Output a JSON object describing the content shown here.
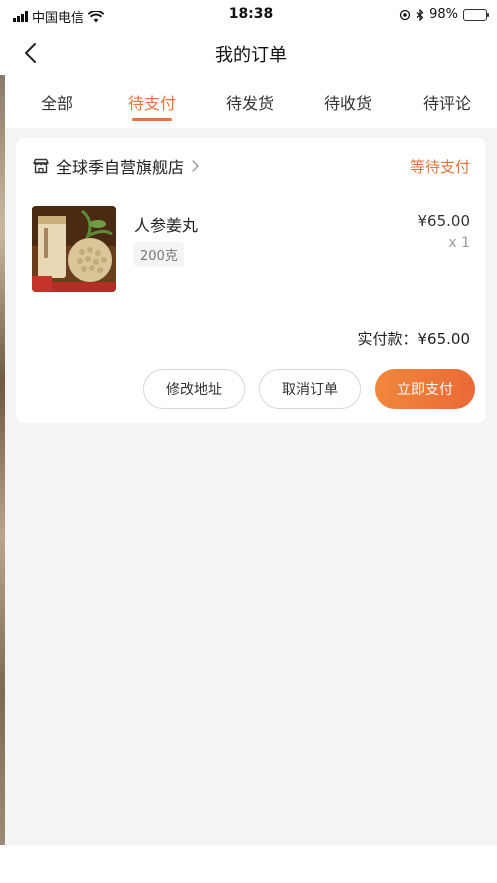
{
  "status_bar": {
    "carrier": "中国电信",
    "time": "18:38",
    "battery_percent": "98%",
    "icons": [
      "signal-icon",
      "wifi-icon",
      "location-icon",
      "bluetooth-icon",
      "battery-icon"
    ]
  },
  "nav": {
    "title": "我的订单",
    "back_icon": "chevron-left-icon"
  },
  "tabs": [
    {
      "label": "全部",
      "active": false
    },
    {
      "label": "待支付",
      "active": true
    },
    {
      "label": "待发货",
      "active": false
    },
    {
      "label": "待收货",
      "active": false
    },
    {
      "label": "待评论",
      "active": false
    }
  ],
  "order": {
    "store_name": "全球季自营旗舰店",
    "status": "等待支付",
    "product": {
      "name": "人参姜丸",
      "spec": "200克",
      "price": "¥65.00",
      "quantity": "x 1"
    },
    "paid_amount_label": "实付款：¥65.00",
    "actions": {
      "modify_address": "修改地址",
      "cancel_order": "取消订单",
      "pay_now": "立即支付"
    }
  },
  "colors": {
    "accent": "#e8743b",
    "page_bg": "#f4f4f4",
    "card_bg": "#ffffff"
  }
}
